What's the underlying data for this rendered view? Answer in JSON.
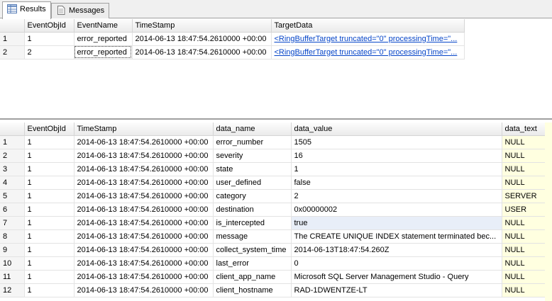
{
  "tabs": [
    {
      "label": "Results",
      "icon": "grid-icon",
      "active": true
    },
    {
      "label": "Messages",
      "icon": "document-icon",
      "active": false
    }
  ],
  "top_grid": {
    "columns": [
      "",
      "EventObjId",
      "EventName",
      "TimeStamp",
      "TargetData"
    ],
    "rows": [
      {
        "num": "1",
        "EventObjId": "1",
        "EventName": "error_reported",
        "TimeStamp": "2014-06-13 18:47:54.2610000 +00:00",
        "TargetData": "<RingBufferTarget truncated=\"0\" processingTime=\"..."
      },
      {
        "num": "2",
        "EventObjId": "2",
        "EventName": "error_reported",
        "TimeStamp": "2014-06-13 18:47:54.2610000 +00:00",
        "TargetData": "<RingBufferTarget truncated=\"0\" processingTime=\"..."
      }
    ]
  },
  "bottom_grid": {
    "columns": [
      "",
      "EventObjId",
      "TimeStamp",
      "data_name",
      "data_value",
      "data_text"
    ],
    "rows": [
      {
        "num": "1",
        "EventObjId": "1",
        "TimeStamp": "2014-06-13 18:47:54.2610000 +00:00",
        "data_name": "error_number",
        "data_value": "1505",
        "data_text": "NULL"
      },
      {
        "num": "2",
        "EventObjId": "1",
        "TimeStamp": "2014-06-13 18:47:54.2610000 +00:00",
        "data_name": "severity",
        "data_value": "16",
        "data_text": "NULL"
      },
      {
        "num": "3",
        "EventObjId": "1",
        "TimeStamp": "2014-06-13 18:47:54.2610000 +00:00",
        "data_name": "state",
        "data_value": "1",
        "data_text": "NULL"
      },
      {
        "num": "4",
        "EventObjId": "1",
        "TimeStamp": "2014-06-13 18:47:54.2610000 +00:00",
        "data_name": "user_defined",
        "data_value": "false",
        "data_text": "NULL"
      },
      {
        "num": "5",
        "EventObjId": "1",
        "TimeStamp": "2014-06-13 18:47:54.2610000 +00:00",
        "data_name": "category",
        "data_value": "2",
        "data_text": "SERVER"
      },
      {
        "num": "6",
        "EventObjId": "1",
        "TimeStamp": "2014-06-13 18:47:54.2610000 +00:00",
        "data_name": "destination",
        "data_value": "0x00000002",
        "data_text": "USER"
      },
      {
        "num": "7",
        "EventObjId": "1",
        "TimeStamp": "2014-06-13 18:47:54.2610000 +00:00",
        "data_name": "is_intercepted",
        "data_value": "true",
        "data_text": "NULL"
      },
      {
        "num": "8",
        "EventObjId": "1",
        "TimeStamp": "2014-06-13 18:47:54.2610000 +00:00",
        "data_name": "message",
        "data_value": "The CREATE UNIQUE INDEX statement terminated bec...",
        "data_text": "NULL"
      },
      {
        "num": "9",
        "EventObjId": "1",
        "TimeStamp": "2014-06-13 18:47:54.2610000 +00:00",
        "data_name": "collect_system_time",
        "data_value": "2014-06-13T18:47:54.260Z",
        "data_text": "NULL"
      },
      {
        "num": "10",
        "EventObjId": "1",
        "TimeStamp": "2014-06-13 18:47:54.2610000 +00:00",
        "data_name": "last_error",
        "data_value": "0",
        "data_text": "NULL"
      },
      {
        "num": "11",
        "EventObjId": "1",
        "TimeStamp": "2014-06-13 18:47:54.2610000 +00:00",
        "data_name": "client_app_name",
        "data_value": "Microsoft SQL Server Management Studio - Query",
        "data_text": "NULL"
      },
      {
        "num": "12",
        "EventObjId": "1",
        "TimeStamp": "2014-06-13 18:47:54.2610000 +00:00",
        "data_name": "client_hostname",
        "data_value": "RAD-1DWENTZE-LT",
        "data_text": "NULL"
      }
    ]
  }
}
